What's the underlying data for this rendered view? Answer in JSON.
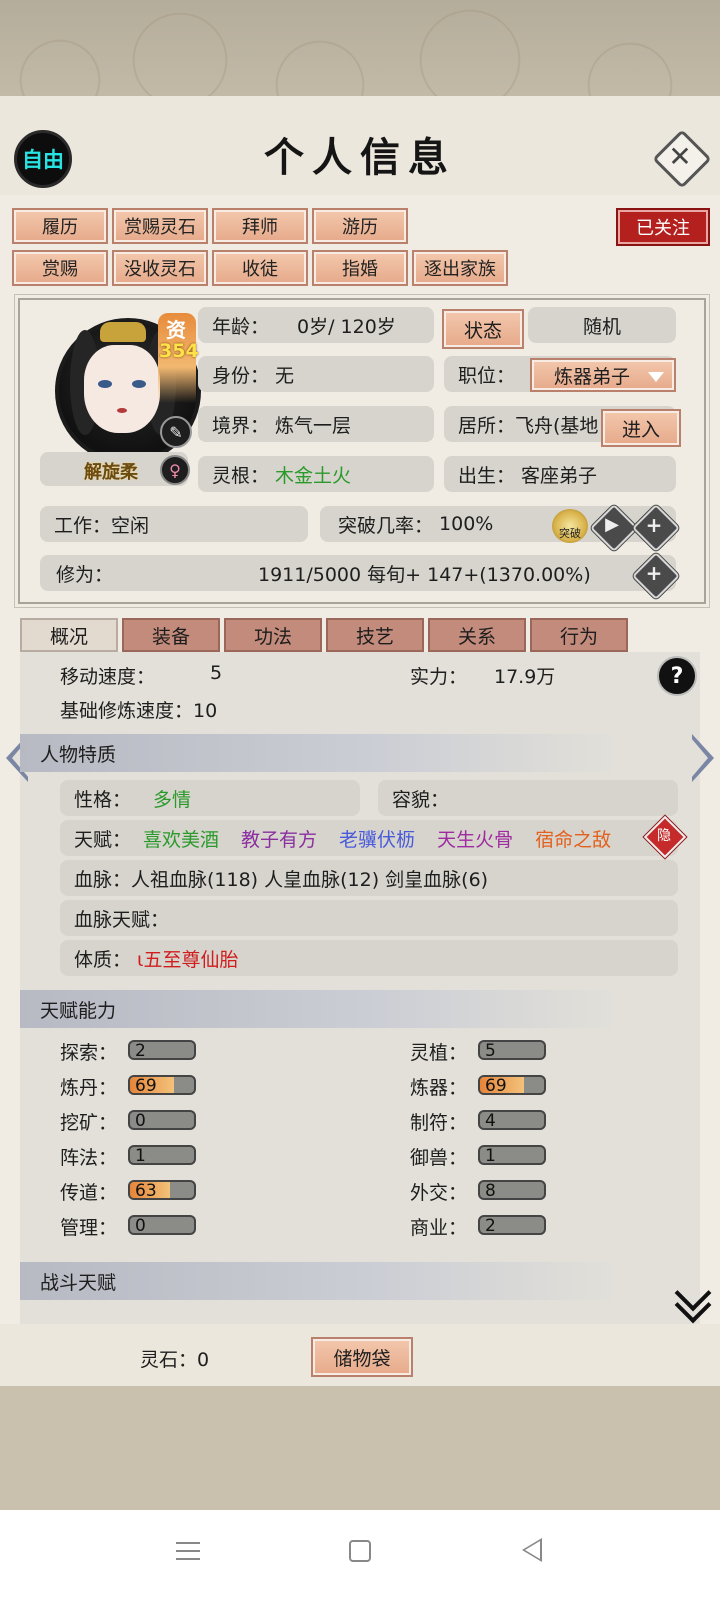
{
  "header": {
    "free_label": "自由",
    "title": "个人信息"
  },
  "action_buttons": {
    "row1": [
      "履历",
      "赏赐灵石",
      "拜师",
      "游历"
    ],
    "row2": [
      "赏赐",
      "没收灵石",
      "收徒",
      "指婚",
      "逐出家族"
    ],
    "followed": "已关注"
  },
  "profile": {
    "aptitude_char": "资",
    "aptitude_value": "354",
    "name": "解旋柔",
    "age_label": "年龄：",
    "age_value": "0岁/ 120岁",
    "status_button": "状态",
    "random_button": "随机",
    "identity_label": "身份：",
    "identity_value": "无",
    "position_label": "职位：",
    "position_value": "炼器弟子",
    "realm_label": "境界：",
    "realm_value": "炼气一层",
    "residence_label": "居所：",
    "residence_value": "飞舟(基地",
    "enter_button": "进入",
    "root_label": "灵根：",
    "root_value": "木金土火",
    "birth_label": "出生：",
    "birth_value": "客座弟子",
    "work": "工作：空闲",
    "breakthrough_label": "突破几率：",
    "breakthrough_value": "100%",
    "breakthrough_icon_text": "突破",
    "cultivation_label": "修为：",
    "cultivation_value": "1911/5000  每旬+  147+(1370.00%)"
  },
  "tabs": [
    "概况",
    "装备",
    "功法",
    "技艺",
    "关系",
    "行为"
  ],
  "overview": {
    "move_speed_label": "移动速度：",
    "move_speed_value": "5",
    "power_label": "实力：",
    "power_value": "17.9万",
    "base_speed": "基础修炼速度：10"
  },
  "traits": {
    "section_title": "人物特质",
    "personality_label": "性格：",
    "personality_value": "多情",
    "appearance_label": "容貌：",
    "talent_label": "天赋：",
    "talents": [
      {
        "text": "喜欢美酒",
        "color": "#2a9a2a"
      },
      {
        "text": "教子有方",
        "color": "#8a2ea0"
      },
      {
        "text": "老骥伏枥",
        "color": "#4a5bd9"
      },
      {
        "text": "天生火骨",
        "color": "#a02aa0"
      },
      {
        "text": "宿命之敌",
        "color": "#e3601e"
      }
    ],
    "hide_badge": "隐",
    "bloodline": "血脉：人祖血脉(118)   人皇血脉(12)     剑皇血脉(6)",
    "bloodline_talent": "血脉天赋：",
    "physique_label": "体质：",
    "physique_value": "ɩ五至尊仙胎"
  },
  "abilities": {
    "section_title": "天赋能力",
    "left": [
      {
        "label": "探索：",
        "value": "2",
        "level": 0
      },
      {
        "label": "炼丹：",
        "value": "69",
        "level": 0.69
      },
      {
        "label": "挖矿：",
        "value": "0",
        "level": 0
      },
      {
        "label": "阵法：",
        "value": "1",
        "level": 0
      },
      {
        "label": "传道：",
        "value": "63",
        "level": 0.63
      },
      {
        "label": "管理：",
        "value": "0",
        "level": 0
      }
    ],
    "right": [
      {
        "label": "灵植：",
        "value": "5",
        "level": 0
      },
      {
        "label": "炼器：",
        "value": "69",
        "level": 0.69
      },
      {
        "label": "制符：",
        "value": "4",
        "level": 0
      },
      {
        "label": "御兽：",
        "value": "1",
        "level": 0
      },
      {
        "label": "外交：",
        "value": "8",
        "level": 0
      },
      {
        "label": "商业：",
        "value": "2",
        "level": 0
      }
    ]
  },
  "combat": {
    "section_title": "战斗天赋"
  },
  "footer": {
    "spirit_stone": "灵石：0",
    "bag_button": "储物袋"
  },
  "icons": [
    "close-icon",
    "pen-icon",
    "female-icon",
    "breakthrough-icon",
    "play-icon",
    "plus-icon",
    "help-icon",
    "left-arrow-icon",
    "right-arrow-icon",
    "scroll-down-icon",
    "menu-icon",
    "home-icon",
    "back-icon"
  ]
}
